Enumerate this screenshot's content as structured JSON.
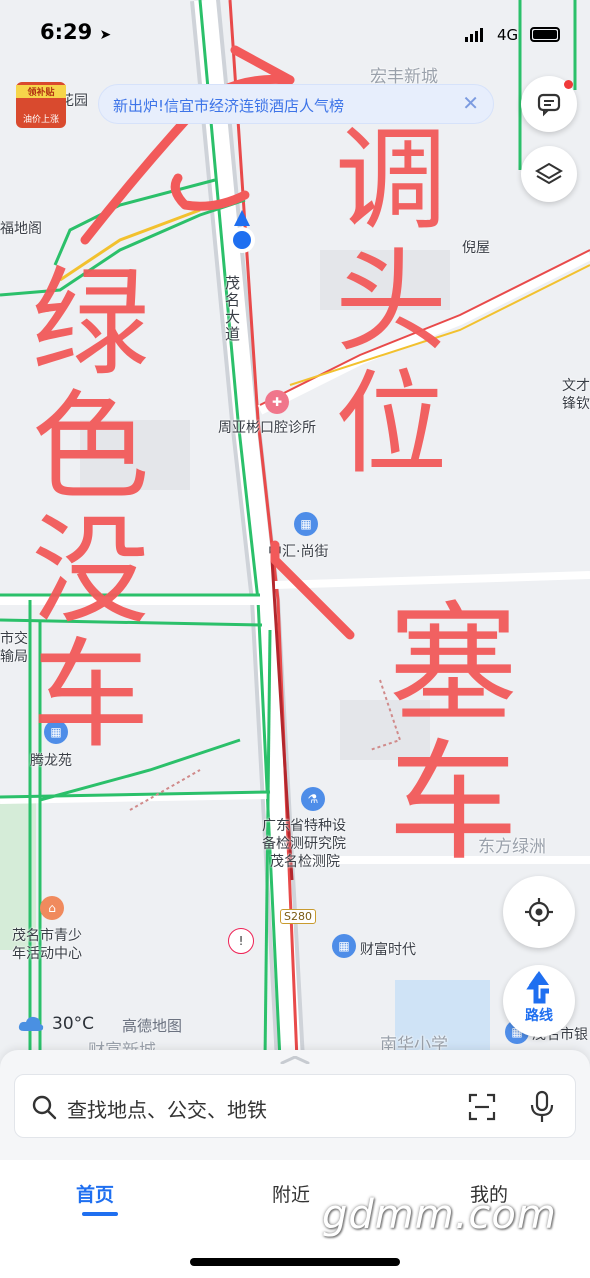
{
  "status_bar": {
    "time": "6:29",
    "network": "4G"
  },
  "promo_badge": {
    "top": "领补贴",
    "bottom": "油价上涨"
  },
  "notice_banner": {
    "text": "新出炉!信宜市经济连锁酒店人气榜"
  },
  "map": {
    "road_name": "茂名大道",
    "highway_shield": "S280",
    "labels": {
      "hongfeng": "宏丰新城",
      "huayuan": "花园",
      "dianai": "福地阁",
      "nifang": "倪屋",
      "wenfeng": "文才",
      "wenfeng2": "锋钦",
      "clinic": "周亚彬口腔诊所",
      "zhonghui": "中汇·尚街",
      "transport1": "市交",
      "transport2": "输局",
      "tenglong": "腾龙苑",
      "inspection1": "广东省特种设",
      "inspection2": "备检测研究院",
      "inspection3": "茂名检测院",
      "dongfang": "东方绿洲",
      "youth1": "茂名市青少",
      "youth2": "年活动中心",
      "caifu": "财富时代",
      "nanhua": "南华小学",
      "caifu_city": "财富新城",
      "maoming_right": "茂名市银"
    },
    "annotations": [
      "调头位",
      "绿色没车",
      "塞车"
    ],
    "colors": {
      "green_road": "#2bc06a",
      "red_road": "#e84a4a",
      "handwriting": "#f25a5a",
      "location": "#1f6ff0"
    }
  },
  "weather": {
    "temperature": "30°C",
    "icon": "cloud-icon"
  },
  "brand": "高德地图",
  "route_button": {
    "label": "路线"
  },
  "search": {
    "placeholder": "查找地点、公交、地铁"
  },
  "tabs": [
    {
      "label": "首页",
      "active": true
    },
    {
      "label": "附近",
      "active": false
    },
    {
      "label": "我的",
      "active": false
    }
  ],
  "watermark": "gdmm.com"
}
